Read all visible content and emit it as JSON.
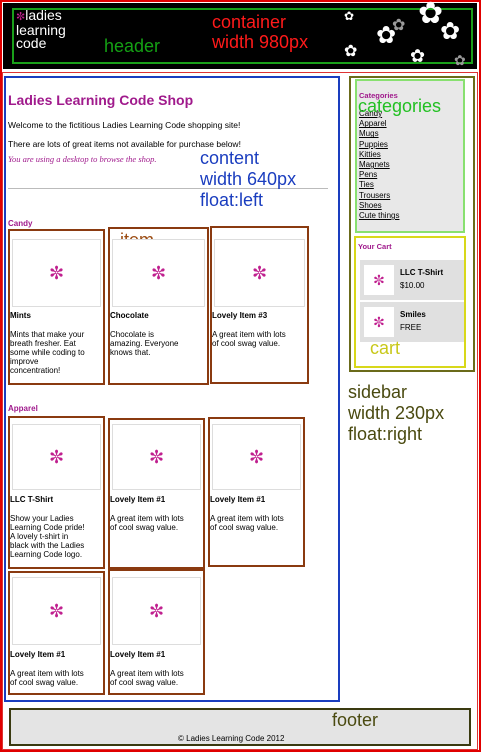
{
  "header": {
    "logo_lines": [
      "ladies",
      "learning",
      "code"
    ],
    "label": "header",
    "container_label": [
      "container",
      "width 980px"
    ]
  },
  "content": {
    "title": "Ladies Learning Code Shop",
    "intro1": "Welcome to the fictitious Ladies Learning Code shopping site!",
    "intro2": "There are lots of great items not available for purchase below!",
    "device_note": "You are using a desktop to browse the shop.",
    "label_lines": [
      "content",
      "width 640px",
      "float:left"
    ],
    "item_label": "item"
  },
  "candy": {
    "heading": "Candy",
    "items": [
      {
        "name": "Mints",
        "desc": [
          "Mints that make your",
          "breath fresher. Eat",
          "some while coding to",
          "improve",
          "concentration!"
        ]
      },
      {
        "name": "Chocolate",
        "desc": [
          "Chocolate is",
          "amazing. Everyone",
          "knows that."
        ]
      },
      {
        "name": "Lovely Item #3",
        "desc": [
          "A great item with lots",
          "of cool swag value."
        ]
      }
    ]
  },
  "apparel": {
    "heading": "Apparel",
    "items": [
      {
        "name": "LLC T-Shirt",
        "desc": [
          "Show your Ladies",
          "Learning Code pride!",
          "A lovely t-shirt in",
          "black with the Ladies",
          "Learning Code logo."
        ]
      },
      {
        "name": "Lovely Item #1",
        "desc": [
          "A great item with lots",
          "of cool swag value."
        ]
      },
      {
        "name": "Lovely Item #1",
        "desc": [
          "A great item with lots",
          "of cool swag value."
        ]
      },
      {
        "name": "Lovely Item #1",
        "desc": [
          "A great item with lots",
          "of cool swag value."
        ]
      },
      {
        "name": "Lovely Item #1",
        "desc": [
          "A great item with lots",
          "of cool swag value."
        ]
      }
    ]
  },
  "sidebar": {
    "label_lines": [
      "sidebar",
      "width 230px",
      "float:right"
    ],
    "categories_heading": "Categories",
    "categories_label": "categories",
    "categories": [
      "Candy",
      "Apparel",
      "Mugs",
      "Puppies",
      "Kitties",
      "Magnets",
      "Pens",
      "Ties",
      "Trousers",
      "Shoes",
      "Cute things"
    ],
    "cart_heading": "Your Cart",
    "cart_label": "cart",
    "cart_items": [
      {
        "name": "LLC T-Shirt",
        "price": "$10.00"
      },
      {
        "name": "Smiles",
        "price": "FREE"
      }
    ]
  },
  "footer": {
    "label": "footer",
    "copyright": "© Ladies Learning Code 2012"
  },
  "icons": {
    "product": "asterisk-logo-icon",
    "flower": "flower-icon"
  },
  "colors": {
    "accent": "#a01a8c",
    "container": "#e00000",
    "content": "#1a3dbf",
    "item": "#8a3a10",
    "header": "#1aa01a",
    "cart": "#d8d81a"
  }
}
